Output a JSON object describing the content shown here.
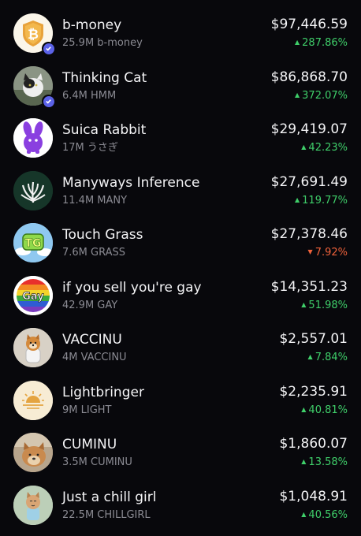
{
  "tokens": [
    {
      "name": "b-money",
      "sub": "25.9M b-money",
      "price": "$97,446.59",
      "change": "287.86%",
      "direction": "up",
      "verified": true,
      "icon": "bitcoin-shield-icon"
    },
    {
      "name": "Thinking Cat",
      "sub": "6.4M HMM",
      "price": "$86,868.70",
      "change": "372.07%",
      "direction": "up",
      "verified": true,
      "icon": "cat-photo-icon"
    },
    {
      "name": "Suica Rabbit",
      "sub": "17M うさぎ",
      "price": "$29,419.07",
      "change": "42.23%",
      "direction": "up",
      "verified": false,
      "icon": "purple-rabbit-icon"
    },
    {
      "name": "Manyways Inference",
      "sub": "11.4M MANY",
      "price": "$27,691.49",
      "change": "119.77%",
      "direction": "up",
      "verified": false,
      "icon": "plant-leaves-icon"
    },
    {
      "name": "Touch Grass",
      "sub": "7.6M GRASS",
      "price": "$27,378.46",
      "change": "7.92%",
      "direction": "down",
      "verified": false,
      "icon": "tg-grass-icon"
    },
    {
      "name": "if you sell you're gay",
      "sub": "42.9M GAY",
      "price": "$14,351.23",
      "change": "51.98%",
      "direction": "up",
      "verified": false,
      "icon": "rainbow-gay-icon"
    },
    {
      "name": "VACCINU",
      "sub": "4M VACCINU",
      "price": "$2,557.01",
      "change": "7.84%",
      "direction": "up",
      "verified": false,
      "icon": "dog-astronaut-icon"
    },
    {
      "name": "Lightbringer",
      "sub": "9M LIGHT",
      "price": "$2,235.91",
      "change": "40.81%",
      "direction": "up",
      "verified": false,
      "icon": "sunrise-icon"
    },
    {
      "name": "CUMINU",
      "sub": "3.5M CUMINU",
      "price": "$1,860.07",
      "change": "13.58%",
      "direction": "up",
      "verified": false,
      "icon": "dog-photo-icon"
    },
    {
      "name": "Just a chill girl",
      "sub": "22.5M CHILLGIRL",
      "price": "$1,048.91",
      "change": "40.56%",
      "direction": "up",
      "verified": false,
      "icon": "chill-dog-icon"
    }
  ],
  "colors": {
    "up": "#3fcf6a",
    "down": "#f0623b",
    "verified": "#5b62e8"
  },
  "arrows": {
    "up": "▲",
    "down": "▼"
  }
}
